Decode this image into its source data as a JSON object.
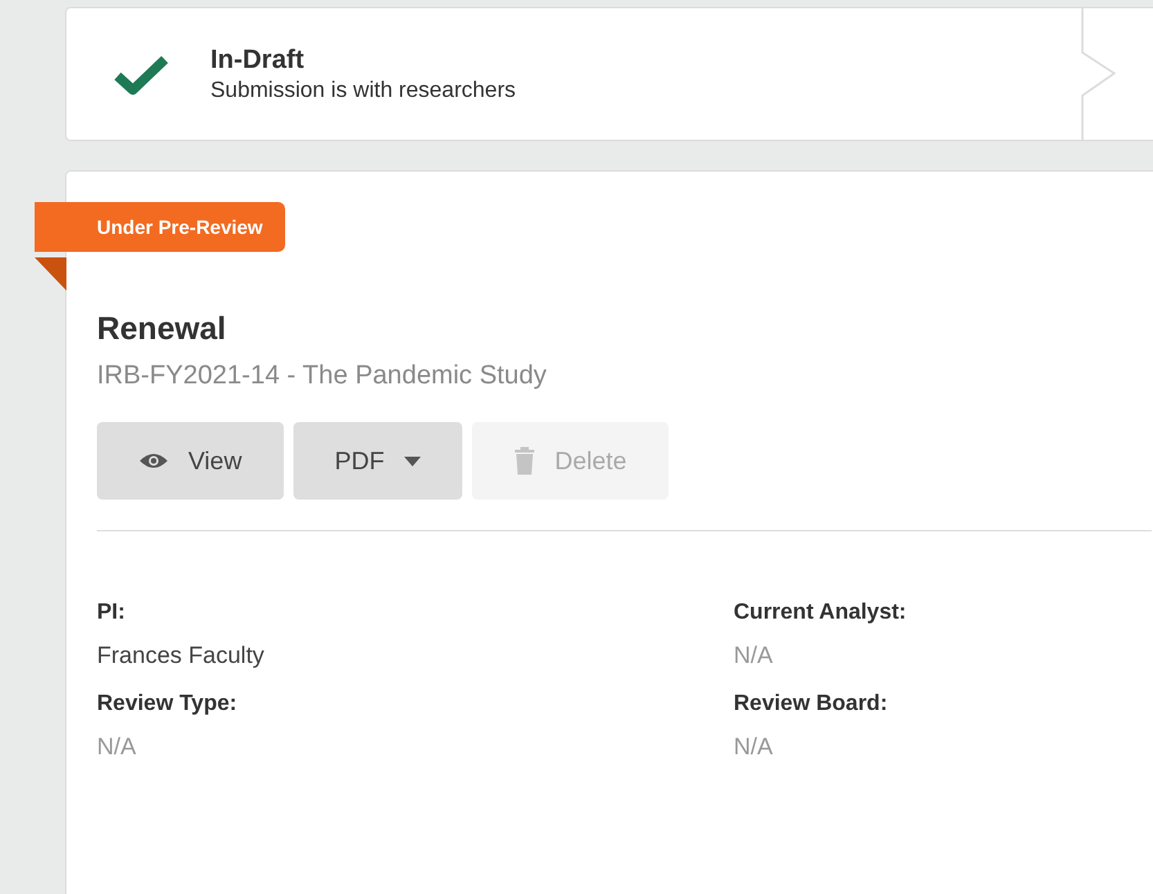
{
  "steps": [
    {
      "title": "In-Draft",
      "subtitle": "Submission is with researchers",
      "done": true
    }
  ],
  "submission": {
    "status_badge": "Under Pre-Review",
    "title": "Renewal",
    "subtitle": "IRB-FY2021-14 - The Pandemic Study",
    "buttons": [
      {
        "label": "View",
        "kind": "view",
        "disabled": false
      },
      {
        "label": "PDF",
        "kind": "dropdown",
        "disabled": false
      },
      {
        "label": "Delete",
        "kind": "delete",
        "disabled": true
      }
    ],
    "fields": [
      {
        "label": "PI:",
        "value": "Frances Faculty",
        "muted": false
      },
      {
        "label": "Current Analyst:",
        "value": "N/A",
        "muted": true
      },
      {
        "label": "Review Type:",
        "value": "N/A",
        "muted": true
      },
      {
        "label": "Review Board:",
        "value": "N/A",
        "muted": true
      }
    ]
  }
}
